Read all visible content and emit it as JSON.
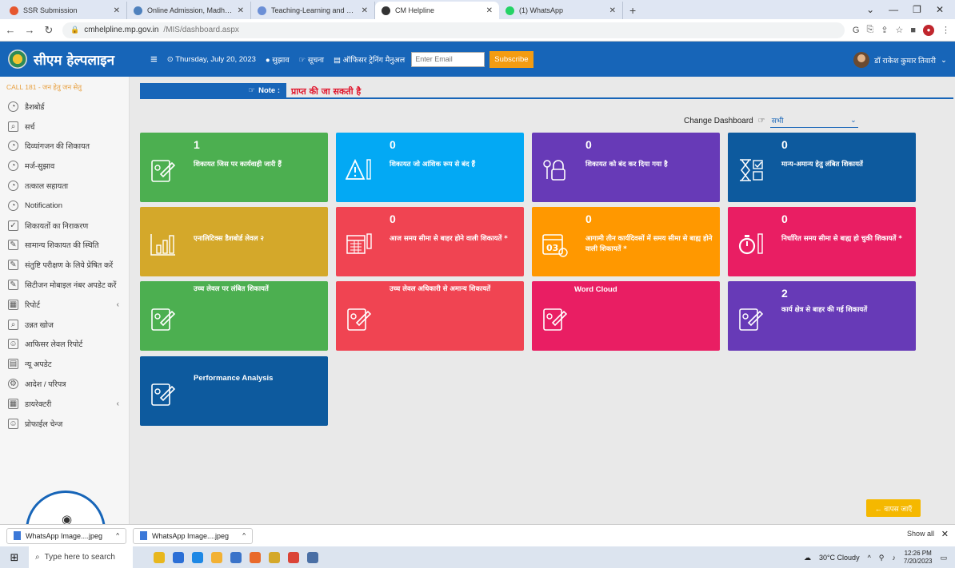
{
  "browser": {
    "tabs": [
      {
        "title": "SSR Submission",
        "color": "#e6572f",
        "active": false
      },
      {
        "title": "Online Admission, Madhya Prade",
        "color": "#4f81bd",
        "active": false
      },
      {
        "title": "Teaching-Learning and Evaluatio",
        "color": "#6b8fd6",
        "active": false
      },
      {
        "title": "CM Helpline",
        "color": "#333333",
        "active": true
      },
      {
        "title": "(1) WhatsApp",
        "color": "#25d366",
        "active": false
      }
    ],
    "url_host": "cmhelpline.mp.gov.in",
    "url_path": "/MIS/dashboard.aspx"
  },
  "header": {
    "brand": "सीएम हेल्पलाइन",
    "date": "Thursday, July 20, 2023",
    "suggestion": "सुझाव",
    "info": "सूचना",
    "training": "ऑफिसर ट्रेनिंग मैनुअल",
    "email_placeholder": "Enter Email",
    "subscribe": "Subscribe",
    "user": "डॉ राकेश कुमार तिवारी"
  },
  "sidebar": {
    "call": "CALL 181 - जन हेतु जन सेतु",
    "items": [
      {
        "label": "डैशबोर्ड",
        "icon": "dashboard-icon"
      },
      {
        "label": "सर्च",
        "icon": "search-doc-icon"
      },
      {
        "label": "दिव्यांगजन की शिकायत",
        "icon": "disabled-icon"
      },
      {
        "label": "मर्ज-सुझाव",
        "icon": "merge-icon"
      },
      {
        "label": "तत्काल सहायता",
        "icon": "help-icon"
      },
      {
        "label": "Notification",
        "icon": "notification-icon"
      },
      {
        "label": "शिकायतों का निराकरण",
        "icon": "resolve-icon"
      },
      {
        "label": "सामान्य शिकायत की स्थिति",
        "icon": "status-icon"
      },
      {
        "label": "संतुष्टि परीक्षण के लिये प्रेषित करें",
        "icon": "send-icon"
      },
      {
        "label": "सिटीजन मोबाइल नंबर अपडेट करें",
        "icon": "mobile-update-icon"
      },
      {
        "label": "रिपोर्ट",
        "icon": "report-icon",
        "chevron": "‹"
      },
      {
        "label": "उन्नत खोज",
        "icon": "advanced-search-icon"
      },
      {
        "label": "आफिसर लेवल रिपोर्ट",
        "icon": "officer-report-icon"
      },
      {
        "label": "न्यू अपडेट",
        "icon": "new-update-icon"
      },
      {
        "label": "आदेश / परिपत्र",
        "icon": "order-icon"
      },
      {
        "label": "डायरेक्टरी",
        "icon": "directory-icon",
        "chevron": "‹"
      },
      {
        "label": "प्रोफाईल चेन्ज",
        "icon": "profile-change-icon"
      }
    ]
  },
  "note": {
    "label": "Note :",
    "text": "प्राप्त की जा सकती है"
  },
  "change_dashboard": {
    "label": "Change Dashboard",
    "selected": "सभी"
  },
  "cards": [
    {
      "count": "1",
      "label": "शिकायत जिस पर कार्यवाही जारी हैं",
      "color": "#4caf50",
      "icon": "edit-icon"
    },
    {
      "count": "0",
      "label": "शिकायत जो आंशिक रूप से बंद हैं",
      "color": "#03a9f4",
      "icon": "warning-icon"
    },
    {
      "count": "0",
      "label": "शिकायत को बंद कर दिया गया है",
      "color": "#673ab7",
      "icon": "lock-icon"
    },
    {
      "count": "0",
      "label": "मान्य-अमान्य हेतु लंबित शिकायतें",
      "color": "#0d5a9e",
      "icon": "hourglass-icon"
    },
    {
      "count": "",
      "label": "एनालिटिक्स डैशबोर्ड लेवल २",
      "color": "#d4a82a",
      "icon": "analytics-icon"
    },
    {
      "count": "0",
      "label": "आज समय सीमा से बाहर होने वाली शिकायतें *",
      "color": "#f04452",
      "icon": "calendar-icon"
    },
    {
      "count": "0",
      "label": "आगामी तीन कार्यदिवसों में समय सीमा से बाह्य होने वाली शिकायतें *",
      "color": "#ff9800",
      "icon": "calendar-03-icon"
    },
    {
      "count": "0",
      "label": "निर्धारित समय सीमा से बाह्य हो चुकी शिकायतें *",
      "color": "#e91e63",
      "icon": "stopwatch-icon"
    },
    {
      "count": "",
      "label": "उच्च लेवल पर लंबित शिकायतें",
      "color": "#4caf50",
      "icon": "edit-icon"
    },
    {
      "count": "",
      "label": "उच्च लेवल अधिकारी से अमान्य शिकायतें",
      "color": "#f04452",
      "icon": "edit-icon"
    },
    {
      "count": "",
      "label": "Word Cloud",
      "color": "#e91e63",
      "icon": "edit-icon"
    },
    {
      "count": "2",
      "label": "कार्य क्षेत्र से बाहर की गई शिकायतें",
      "color": "#673ab7",
      "icon": "edit-icon"
    },
    {
      "count": "",
      "label": "Performance Analysis",
      "color": "#0d5a9e",
      "icon": "edit-icon"
    }
  ],
  "back_button": "← वापस जाएँ",
  "downloads": {
    "items": [
      "WhatsApp Image....jpeg",
      "WhatsApp Image....jpeg"
    ],
    "show_all": "Show all"
  },
  "taskbar": {
    "search_placeholder": "Type here to search",
    "weather": "30°C Cloudy",
    "time": "12:26 PM",
    "date": "7/20/2023"
  }
}
